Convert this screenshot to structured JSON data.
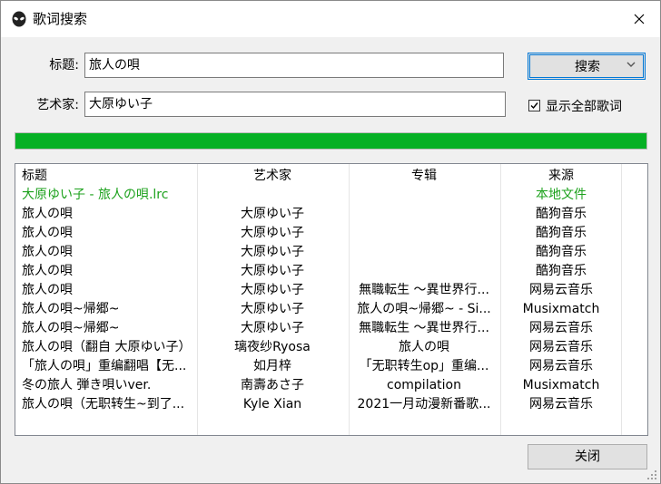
{
  "window": {
    "title": "歌词搜索"
  },
  "form": {
    "title_label": "标题:",
    "title_value": "旅人の唄",
    "artist_label": "艺术家:",
    "artist_value": "大原ゆい子",
    "search_label": "搜索",
    "show_all_label": "显示全部歌词",
    "show_all_checked": true
  },
  "progress": {
    "percent": 100,
    "color": "#06b025"
  },
  "colors": {
    "local_accent": "#1ca11c",
    "focus_border": "#0078d7"
  },
  "icons": {
    "app": "alien-head-icon",
    "close": "close-icon",
    "dropdown": "chevron-down-icon",
    "check": "checkmark-icon",
    "grip": "resize-grip-icon"
  },
  "table": {
    "headers": [
      "标题",
      "艺术家",
      "专辑",
      "来源"
    ],
    "rows": [
      {
        "title": "大原ゆい子 - 旅人の唄.lrc",
        "artist": "",
        "album": "",
        "source": "本地文件",
        "local": true
      },
      {
        "title": "旅人の唄",
        "artist": "大原ゆい子",
        "album": "",
        "source": "酷狗音乐"
      },
      {
        "title": "旅人の唄",
        "artist": "大原ゆい子",
        "album": "",
        "source": "酷狗音乐"
      },
      {
        "title": "旅人の唄",
        "artist": "大原ゆい子",
        "album": "",
        "source": "酷狗音乐"
      },
      {
        "title": "旅人の唄",
        "artist": "大原ゆい子",
        "album": "",
        "source": "酷狗音乐"
      },
      {
        "title": "旅人の唄",
        "artist": "大原ゆい子",
        "album": "無職転生 ～異世界行...",
        "source": "网易云音乐"
      },
      {
        "title": "旅人の唄~帰郷~",
        "artist": "大原ゆい子",
        "album": "旅人の唄~帰郷~ - Si...",
        "source": "Musixmatch"
      },
      {
        "title": "旅人の唄~帰郷~",
        "artist": "大原ゆい子",
        "album": "無職転生 ～異世界行...",
        "source": "网易云音乐"
      },
      {
        "title": "旅人の唄（翻自 大原ゆい子）",
        "artist": "璃夜纱Ryosa",
        "album": "旅人の唄",
        "source": "网易云音乐"
      },
      {
        "title": "「旅人の唄」重编翻唱【无...",
        "artist": "如月梓",
        "album": "「无职转生op」重编...",
        "source": "网易云音乐"
      },
      {
        "title": "冬の旅人 弾き唄いver.",
        "artist": "南壽あさ子",
        "album": "compilation",
        "source": "Musixmatch"
      },
      {
        "title": "旅人の唄（无职转生~到了...",
        "artist": "Kyle Xian",
        "album": "2021一月动漫新番歌...",
        "source": "网易云音乐"
      }
    ]
  },
  "footer": {
    "close_label": "关闭"
  }
}
